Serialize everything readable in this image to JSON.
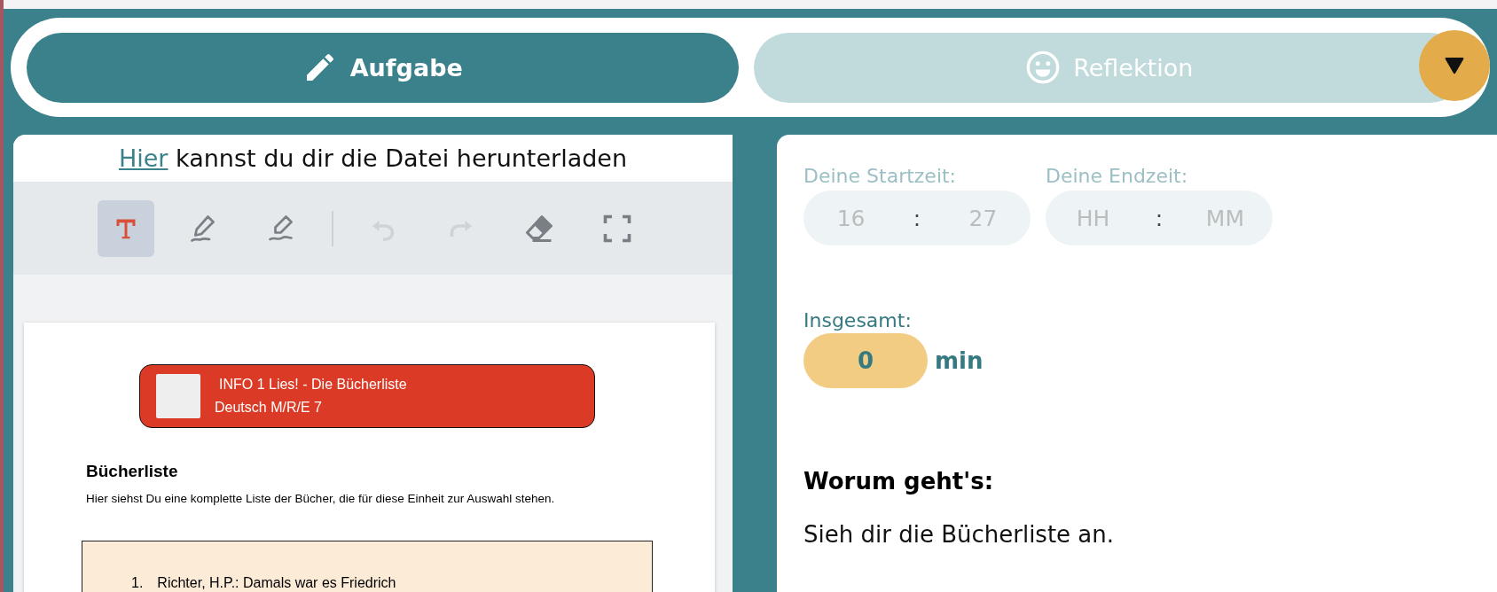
{
  "tabs": [
    {
      "label": "Aufgabe",
      "selected": true
    },
    {
      "label": "Reflektion",
      "selected": false
    }
  ],
  "download": {
    "link": "Hier",
    "text": "kannst du dir die Datei herunterladen"
  },
  "tools": [
    {
      "kind": "text",
      "selected": true,
      "disabled": false
    },
    {
      "kind": "pen",
      "selected": false,
      "disabled": false
    },
    {
      "kind": "highlighter",
      "selected": false,
      "disabled": false
    },
    {
      "kind": "undo",
      "selected": false,
      "disabled": true
    },
    {
      "kind": "redo",
      "selected": false,
      "disabled": true
    },
    {
      "kind": "eraser",
      "selected": false,
      "disabled": false
    },
    {
      "kind": "fullscreen",
      "selected": false,
      "disabled": false
    }
  ],
  "document": {
    "banner_title": "INFO 1 Lies! - Die Bücherliste",
    "banner_subtitle": "Deutsch M/R/E 7",
    "heading": "Bücherliste",
    "intro": "Hier siehst Du eine komplette Liste der Bücher, die für diese Einheit zur Auswahl stehen.",
    "list": [
      {
        "number": "1.",
        "text": "Richter, H.P.: Damals war es Friedrich"
      }
    ]
  },
  "start_time": {
    "label": "Deine Startzeit:",
    "hour_placeholder": "16",
    "separator": ":",
    "minute_placeholder": "27"
  },
  "end_time": {
    "label": "Deine Endzeit:",
    "hour_placeholder": "HH",
    "separator": ":",
    "minute_placeholder": "MM"
  },
  "total": {
    "label": "Insgesamt:",
    "value": "0",
    "unit": "min"
  },
  "task": {
    "heading": "Worum geht's:",
    "lines": [
      "Sieh dir die Bücherliste an."
    ]
  }
}
